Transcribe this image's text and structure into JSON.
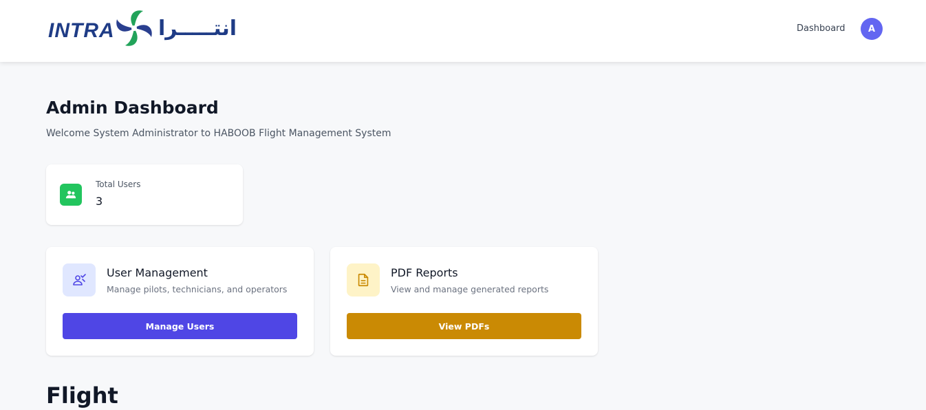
{
  "header": {
    "logo_latin": "INTRA",
    "logo_arabic": "انتـــــرا",
    "nav_dashboard": "Dashboard",
    "avatar_initial": "A"
  },
  "main": {
    "title": "Admin Dashboard",
    "subtitle": "Welcome System Administrator to HABOOB Flight Management System",
    "stats": {
      "total_users_label": "Total Users",
      "total_users_value": "3",
      "icon": "users-icon"
    },
    "actions": [
      {
        "title": "User Management",
        "description": "Manage pilots, technicians, and operators",
        "button_label": "Manage Users",
        "icon": "user-management-icon",
        "accent": "#4f46e5"
      },
      {
        "title": "PDF Reports",
        "description": "View and manage generated reports",
        "button_label": "View PDFs",
        "icon": "document-icon",
        "accent": "#ca8a04"
      }
    ],
    "section_title": "Flight"
  },
  "colors": {
    "brand_blue": "#1f3c86",
    "brand_green": "#22a35a",
    "avatar": "#6366f1",
    "stat_icon": "#22c55e",
    "page_bg": "#f7f8fa"
  }
}
